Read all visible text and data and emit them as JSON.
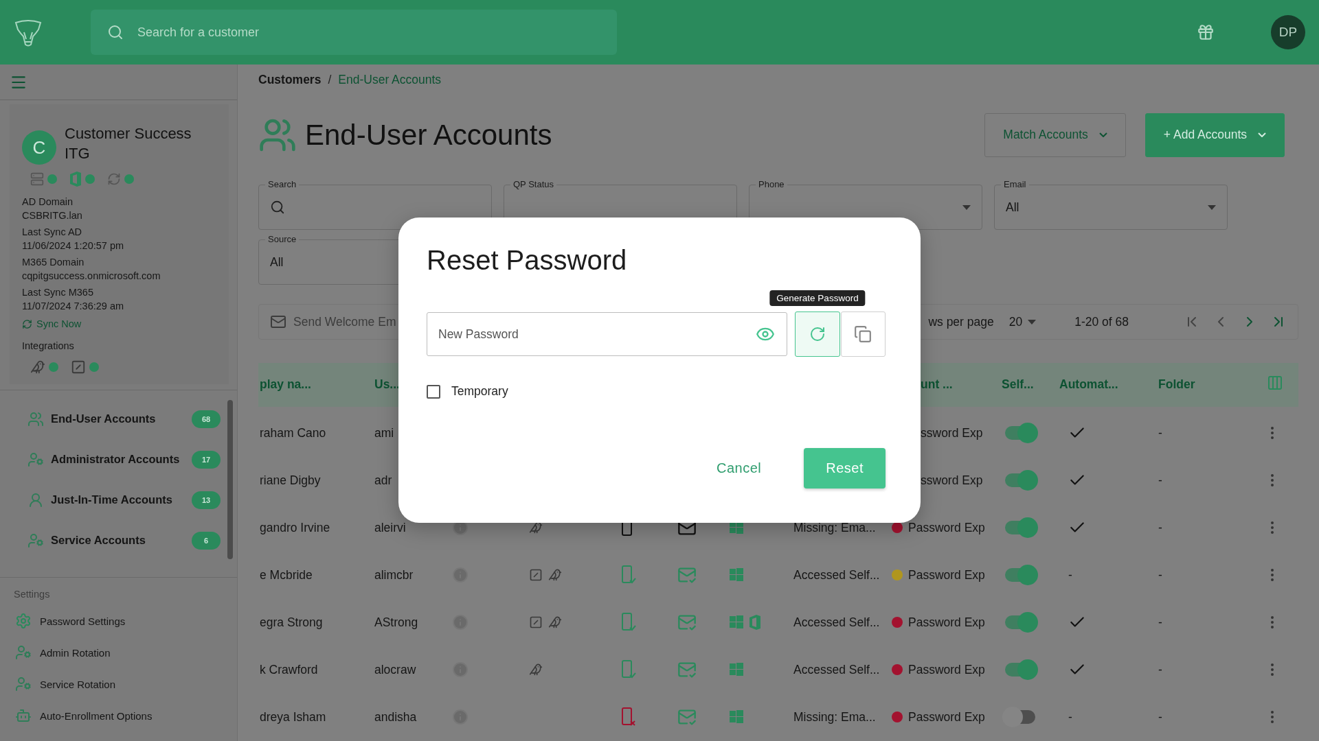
{
  "topbar": {
    "search_placeholder": "Search for a customer",
    "avatar": "DP"
  },
  "sidebar": {
    "customer": {
      "initial": "C",
      "name": "Customer Success ITG",
      "connections": [
        {
          "kind": "server",
          "color": "#2a8a5c"
        },
        {
          "kind": "office",
          "color": "#2a8a5c"
        },
        {
          "kind": "sync",
          "color": "#2a8a5c"
        }
      ],
      "details": [
        {
          "label": "AD Domain",
          "value": "CSBRITG.lan"
        },
        {
          "label": "Last Sync AD",
          "value": "11/06/2024 1:20:57 pm"
        },
        {
          "label": "M365 Domain",
          "value": "cqpitgsuccess.onmicrosoft.com"
        },
        {
          "label": "Last Sync M365",
          "value": "11/07/2024 7:36:29 am"
        }
      ],
      "sync": "Sync Now",
      "integrations_label": "Integrations",
      "integrations": [
        {
          "kind": "bird",
          "color": "#2a8a5c"
        },
        {
          "kind": "box",
          "color": "#2a8a5c"
        }
      ]
    },
    "nav": [
      {
        "kind": "users",
        "label": "End-User Accounts",
        "count": "68"
      },
      {
        "kind": "admin",
        "label": "Administrator Accounts",
        "count": "17"
      },
      {
        "kind": "jit",
        "label": "Just-In-Time Accounts",
        "count": "13"
      },
      {
        "kind": "service",
        "label": "Service Accounts",
        "count": "6"
      }
    ],
    "settings_label": "Settings",
    "settings": [
      {
        "kind": "gear",
        "label": "Password Settings"
      },
      {
        "kind": "admin",
        "label": "Admin Rotation"
      },
      {
        "kind": "service",
        "label": "Service Rotation"
      },
      {
        "kind": "robot",
        "label": "Auto-Enrollment Options"
      }
    ]
  },
  "main": {
    "breadcrumb": {
      "items": [
        "Customers",
        "End-User Accounts"
      ],
      "separator": "/"
    },
    "title": "End-User Accounts",
    "actions": [
      {
        "kind": "outline",
        "label": "Match Accounts"
      },
      {
        "kind": "filled",
        "label": "+ Add Accounts"
      }
    ],
    "filters": [
      {
        "kind": "search",
        "label": "Search"
      },
      {
        "kind": "select",
        "label": "QP Status"
      },
      {
        "kind": "dropdown",
        "label": "Phone"
      },
      {
        "kind": "dropdown",
        "label": "Email",
        "value": "All"
      },
      {
        "kind": "select",
        "label": "Source",
        "value": "All"
      }
    ],
    "toolbar": {
      "send": "Send Welcome Em",
      "rows_label": "ws per page",
      "rows_value": "20",
      "range": "1-20 of 68"
    },
    "table": {
      "columns": [
        "play na...",
        "Us...",
        "unt ...",
        "Self...",
        "Automat...",
        "Folder"
      ],
      "rows": [
        {
          "name": "raham Cano",
          "username": "ami",
          "account": {
            "text": "ssword Exp"
          },
          "self_on": true,
          "automation": {
            "kind": "check"
          },
          "folder": "-"
        },
        {
          "name": "riane Digby",
          "username": "adr",
          "account": {
            "text": "ssword Exp"
          },
          "self_on": true,
          "automation": {
            "kind": "check"
          },
          "folder": "-"
        },
        {
          "name": "gandro Irvine",
          "username": "aleirvi",
          "middle": {
            "integrations": [
              {
                "kind": "bird"
              }
            ],
            "phone": {
              "kind": "plain"
            },
            "email": {
              "kind": "plain"
            },
            "os": [
              {
                "kind": "windows"
              }
            ],
            "status": "Missing: Ema..."
          },
          "account": {
            "text": "Password Exp",
            "color": "#a3122f"
          },
          "self_on": true,
          "automation": {
            "kind": "check"
          },
          "folder": "-"
        },
        {
          "name": "e Mcbride",
          "username": "alimcbr",
          "middle": {
            "integrations": [
              {
                "kind": "box"
              },
              {
                "kind": "bird"
              }
            ],
            "phone": {
              "kind": "ok"
            },
            "email": {
              "kind": "ok"
            },
            "os": [
              {
                "kind": "windows"
              }
            ],
            "status": "Accessed Self..."
          },
          "account": {
            "text": "Password Exp",
            "color": "#b0961e"
          },
          "self_on": true,
          "automation": {
            "kind": "text",
            "text": "-"
          },
          "folder": "-"
        },
        {
          "name": "egra Strong",
          "username": "AStrong",
          "middle": {
            "integrations": [
              {
                "kind": "box"
              },
              {
                "kind": "bird"
              }
            ],
            "phone": {
              "kind": "ok"
            },
            "email": {
              "kind": "ok"
            },
            "os": [
              {
                "kind": "windows"
              },
              {
                "kind": "office"
              }
            ],
            "status": "Accessed Self..."
          },
          "account": {
            "text": "Password Exp",
            "color": "#a3122f"
          },
          "self_on": true,
          "automation": {
            "kind": "check"
          },
          "folder": "-"
        },
        {
          "name": "k Crawford",
          "username": "alocraw",
          "middle": {
            "integrations": [
              {
                "kind": "bird"
              }
            ],
            "phone": {
              "kind": "ok"
            },
            "email": {
              "kind": "ok"
            },
            "os": [
              {
                "kind": "windows"
              }
            ],
            "status": "Accessed Self..."
          },
          "account": {
            "text": "Password Exp",
            "color": "#a3122f"
          },
          "self_on": true,
          "automation": {
            "kind": "check"
          },
          "folder": "-"
        },
        {
          "name": "dreya Isham",
          "username": "andisha",
          "middle": {
            "phone": {
              "kind": "error"
            },
            "email": {
              "kind": "ok"
            },
            "os": [
              {
                "kind": "windows"
              }
            ],
            "status": "Missing: Ema..."
          },
          "account": {
            "text": "Password Exp",
            "color": "#a3122f"
          },
          "self_on": false,
          "automation": {
            "kind": "text",
            "text": "-"
          },
          "folder": "-"
        }
      ]
    }
  },
  "modal": {
    "title": "Reset Password",
    "password": {
      "placeholder": "New Password"
    },
    "tooltip": "Generate Password",
    "temporary": {
      "label": "Temporary",
      "checked": false
    },
    "buttons": [
      {
        "kind": "text",
        "label": "Cancel"
      },
      {
        "kind": "primary",
        "label": "Reset"
      }
    ]
  }
}
